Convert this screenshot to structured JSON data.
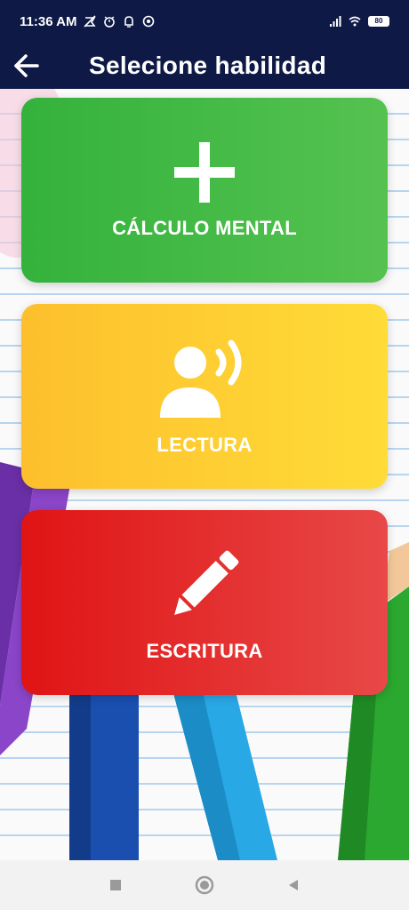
{
  "status_bar": {
    "time": "11:36 AM",
    "battery": "80",
    "icons_left": [
      "muted-cross-icon",
      "alarm-icon",
      "bell-icon",
      "whatsapp-icon"
    ],
    "icons_right": [
      "signal-icon",
      "wifi-icon",
      "battery-icon"
    ]
  },
  "app_bar": {
    "title": "Selecione habilidad",
    "back_icon": "arrow-left-icon"
  },
  "options": [
    {
      "label": "CÁLCULO MENTAL",
      "icon": "plus-icon",
      "color": "#3fb843"
    },
    {
      "label": "LECTURA",
      "icon": "speaking-person-icon",
      "color": "#fecb31"
    },
    {
      "label": "ESCRITURA",
      "icon": "pencil-icon",
      "color": "#e42a2a"
    }
  ],
  "nav_bar": {
    "buttons": [
      "recents-square-icon",
      "home-circle-icon",
      "back-triangle-icon"
    ]
  },
  "colors": {
    "header_bg": "#0e1a45",
    "notebook_line": "#b7d5ef"
  }
}
